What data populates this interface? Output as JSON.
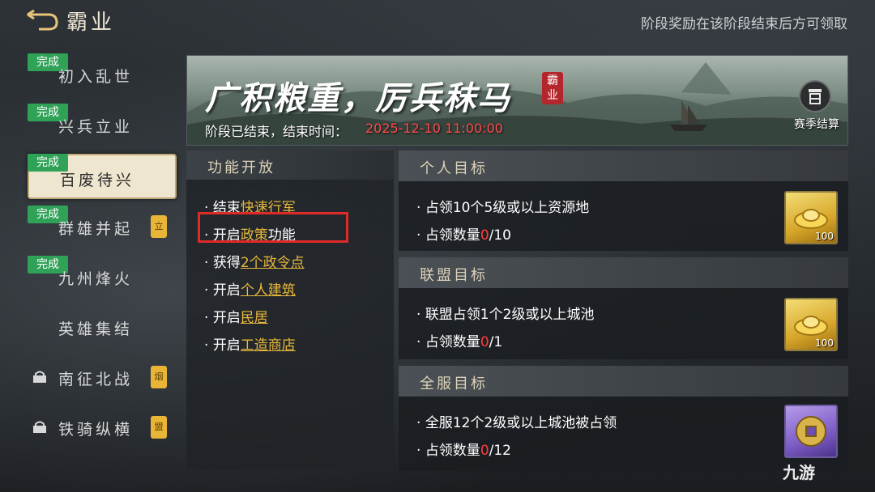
{
  "header": {
    "title": "霸业",
    "notice": "阶段奖励在该阶段结束后方可领取"
  },
  "sidebar": {
    "stages": [
      {
        "name": "初入乱世",
        "done_label": "完成"
      },
      {
        "name": "兴兵立业",
        "done_label": "完成"
      },
      {
        "name": "百废待兴",
        "done_label": "完成"
      },
      {
        "name": "群雄并起",
        "done_label": "完成",
        "tag": "立"
      },
      {
        "name": "九州烽火",
        "done_label": "完成"
      },
      {
        "name": "英雄集结"
      },
      {
        "name": "南征北战",
        "tag": "烟"
      },
      {
        "name": "铁骑纵横",
        "tag": "盟"
      }
    ]
  },
  "banner": {
    "title": "广积粮重，厉兵秣马",
    "seal": "霸业",
    "status": "阶段已结束，结束时间：",
    "end_time": "2025-12-10 11:00:00",
    "season_button": "赛季结算"
  },
  "features": {
    "header": "功能开放",
    "items": [
      {
        "prefix": "结束",
        "highlight": "快速行军",
        "suffix": ""
      },
      {
        "prefix": "开启",
        "highlight": "政策",
        "suffix": "功能"
      },
      {
        "prefix": "获得",
        "highlight": "2个政令点",
        "suffix": ""
      },
      {
        "prefix": "开启",
        "highlight": "个人建筑",
        "suffix": ""
      },
      {
        "prefix": "开启",
        "highlight": "民居",
        "suffix": ""
      },
      {
        "prefix": "开启",
        "highlight": "工造商店",
        "suffix": ""
      }
    ]
  },
  "goals": {
    "personal": {
      "header": "个人目标",
      "task": "占领10个5级或以上资源地",
      "progress_label": "占领数量",
      "current": "0",
      "total": "/10",
      "reward_qty": "100"
    },
    "alliance": {
      "header": "联盟目标",
      "task": "联盟占领1个2级或以上城池",
      "progress_label": "占领数量",
      "current": "0",
      "total": "/1",
      "reward_qty": "100"
    },
    "server": {
      "header": "全服目标",
      "task": "全服12个2级或以上城池被占领",
      "progress_label": "占领数量",
      "current": "0",
      "total": "/12"
    }
  },
  "watermark": "九游",
  "colors": {
    "done_badge": "#2fa257",
    "highlight": "#e7b73b",
    "time_red": "#ff4a4a",
    "selection_box": "#e02a2a"
  }
}
